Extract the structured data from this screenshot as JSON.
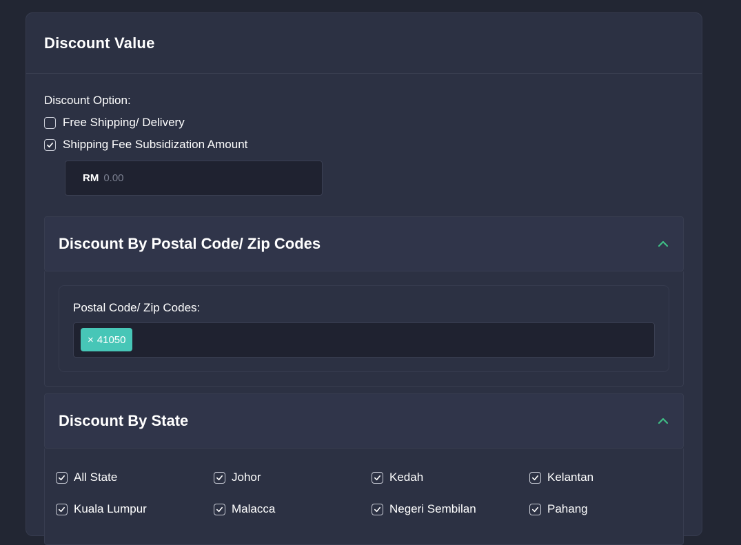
{
  "card": {
    "title": "Discount Value"
  },
  "discount_option": {
    "label": "Discount Option:",
    "options": [
      {
        "label": "Free Shipping/ Delivery",
        "checked": false
      },
      {
        "label": "Shipping Fee Subsidization Amount",
        "checked": true
      }
    ],
    "amount": {
      "prefix": "RM",
      "placeholder": "0.00"
    }
  },
  "postal_section": {
    "title": "Discount By Postal Code/ Zip Codes",
    "field_label": "Postal Code/ Zip Codes:",
    "tags": [
      {
        "remove": "×",
        "value": "41050"
      }
    ]
  },
  "state_section": {
    "title": "Discount By State",
    "states": [
      {
        "label": "All State",
        "checked": true
      },
      {
        "label": "Johor",
        "checked": true
      },
      {
        "label": "Kedah",
        "checked": true
      },
      {
        "label": "Kelantan",
        "checked": true
      },
      {
        "label": "Kuala Lumpur",
        "checked": true
      },
      {
        "label": "Malacca",
        "checked": true
      },
      {
        "label": "Negeri Sembilan",
        "checked": true
      },
      {
        "label": "Pahang",
        "checked": true
      }
    ]
  },
  "colors": {
    "page_bg": "#222633",
    "card_bg": "#2c3143",
    "input_bg": "#1f2230",
    "accent_green": "#3fbf86",
    "tag_teal": "#47c6b7"
  },
  "icons": {
    "checkbox_checked": "check-icon",
    "collapse": "chevron-up-icon"
  }
}
